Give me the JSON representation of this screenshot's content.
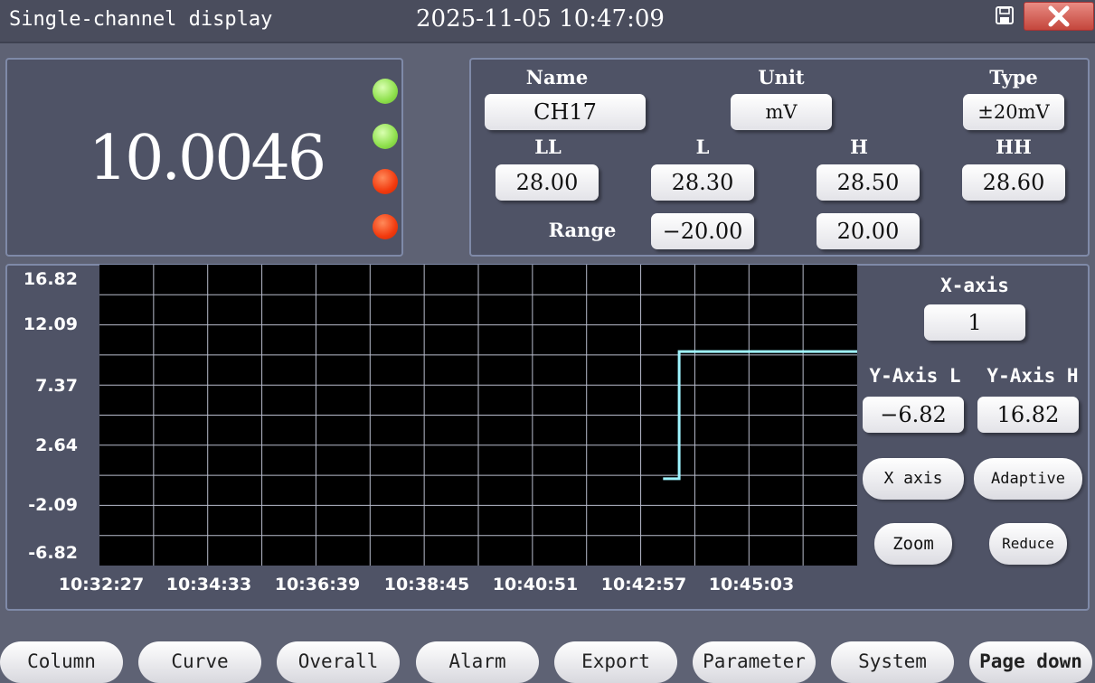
{
  "titlebar": {
    "title": "Single-channel display",
    "datetime": "2025-11-05  10:47:09"
  },
  "reading": {
    "value": "10.0046",
    "indicators": [
      {
        "name": "ll-indicator",
        "color": "#8ee04c"
      },
      {
        "name": "l-indicator",
        "color": "#8ee04c"
      },
      {
        "name": "h-indicator",
        "color": "#f23a0e"
      },
      {
        "name": "hh-indicator",
        "color": "#f23a0e"
      }
    ]
  },
  "channel": {
    "name_label": "Name",
    "name_value": "CH17",
    "unit_label": "Unit",
    "unit_value": "mV",
    "type_label": "Type",
    "type_value": "±20mV",
    "ll_label": "LL",
    "ll_value": "28.00",
    "l_label": "L",
    "l_value": "28.30",
    "h_label": "H",
    "h_value": "28.50",
    "hh_label": "HH",
    "hh_value": "28.60",
    "range_label": "Range",
    "range_low": "−20.00",
    "range_high": "20.00"
  },
  "chart_data": {
    "type": "line",
    "yticks": [
      "16.82",
      "12.09",
      "7.37",
      "2.64",
      "-2.09",
      "-6.82"
    ],
    "xticks": [
      "10:32:27",
      "10:34:33",
      "10:36:39",
      "10:38:45",
      "10:40:51",
      "10:42:57",
      "10:45:03"
    ],
    "ylim": [
      -6.82,
      16.82
    ],
    "xlim": [
      "10:32:27",
      "10:46:34"
    ],
    "grid": true,
    "line_color": "#9ff4ff",
    "series": [
      {
        "x": [
          "10:42:57",
          "10:43:15",
          "10:43:15",
          "10:46:34"
        ],
        "y": [
          0.0,
          0.0,
          10.0,
          10.0
        ]
      }
    ]
  },
  "axis_controls": {
    "x_axis_label": "X-axis",
    "x_axis_value": "1",
    "y_axis_l_label": "Y-Axis L",
    "y_axis_h_label": "Y-Axis H",
    "y_axis_l_value": "−6.82",
    "y_axis_h_value": "16.82",
    "x_axis_button": "X axis",
    "adaptive_button": "Adaptive",
    "zoom_button": "Zoom",
    "reduce_button": "Reduce"
  },
  "nav": [
    "Column",
    "Curve",
    "Overall",
    "Alarm",
    "Export",
    "Parameter",
    "System",
    "Page down"
  ]
}
